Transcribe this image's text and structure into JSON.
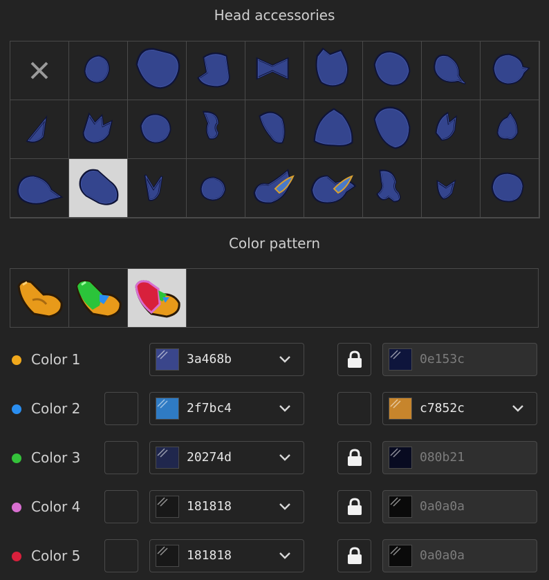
{
  "head_title": "Head accessories",
  "pattern_title": "Color pattern",
  "accessories": [
    "none",
    "hat-1",
    "hat-2",
    "hat-3",
    "bow",
    "hat-5",
    "hat-6",
    "hat-7",
    "hat-8",
    "hat-9",
    "hat-10",
    "hat-11",
    "hat-12",
    "hat-13",
    "hat-14",
    "hat-15",
    "hat-16",
    "hat-17",
    "hat-18",
    "hat-19",
    "hat-20",
    "hat-21",
    "hat-22",
    "hat-23",
    "hat-24",
    "hat-25",
    "hat-26"
  ],
  "accessory_selected_index": 19,
  "patterns_selected_index": 2,
  "colors": [
    {
      "label": "Color 1",
      "dot": "#f0a81c",
      "value": "3a468b",
      "swatch": "#3a468b",
      "has_checkbox": false,
      "locked": true,
      "right_value": "0e153c",
      "right_swatch": "#0e153c"
    },
    {
      "label": "Color 2",
      "dot": "#2a8ef0",
      "value": "2f7bc4",
      "swatch": "#2f7bc4",
      "has_checkbox": true,
      "locked": false,
      "right_value": "c7852c",
      "right_swatch": "#c7852c"
    },
    {
      "label": "Color 3",
      "dot": "#34c23a",
      "value": "20274d",
      "swatch": "#20274d",
      "has_checkbox": true,
      "locked": true,
      "right_value": "080b21",
      "right_swatch": "#080b21"
    },
    {
      "label": "Color 4",
      "dot": "#d86fd0",
      "value": "181818",
      "swatch": "#181818",
      "has_checkbox": true,
      "locked": true,
      "right_value": "0a0a0a",
      "right_swatch": "#0a0a0a"
    },
    {
      "label": "Color 5",
      "dot": "#d8203c",
      "value": "181818",
      "swatch": "#181818",
      "has_checkbox": true,
      "locked": true,
      "right_value": "0a0a0a",
      "right_swatch": "#0a0a0a"
    }
  ]
}
